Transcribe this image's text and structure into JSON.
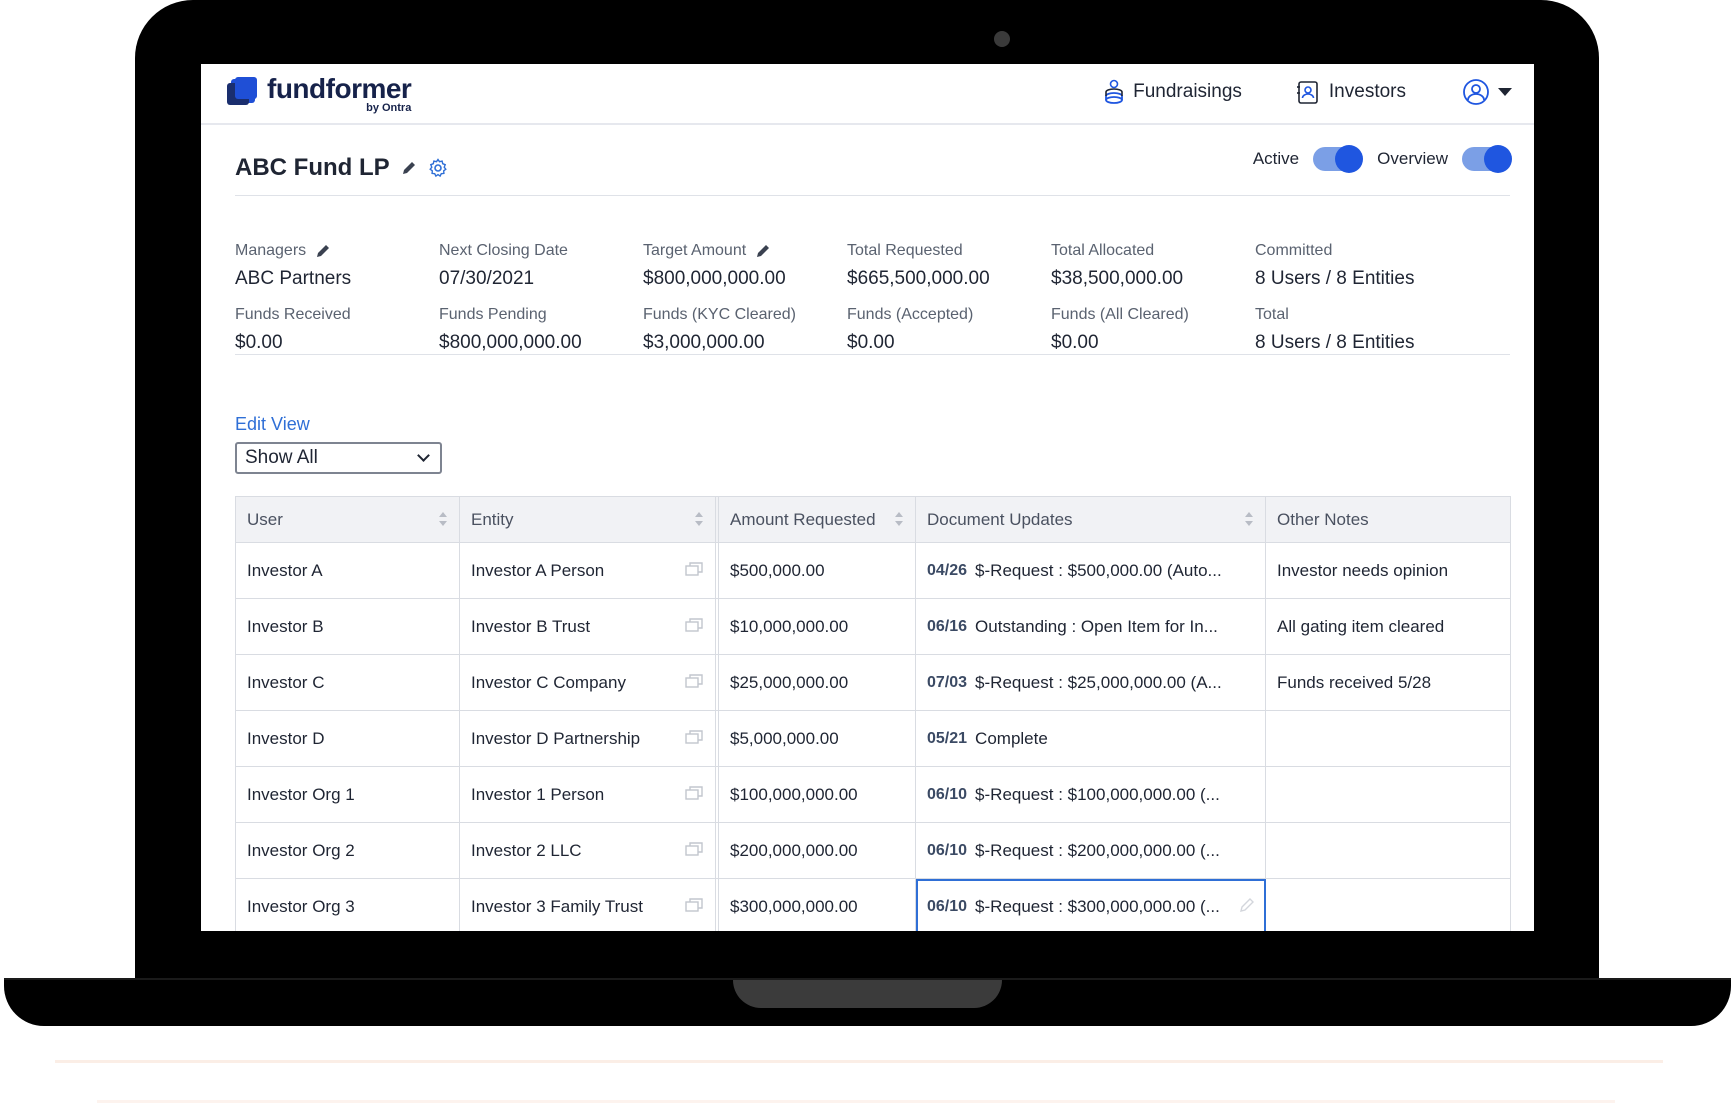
{
  "app": {
    "logo_word": "fundformer",
    "logo_sub": "by Ontra"
  },
  "nav": {
    "fundraisings": "Fundraisings",
    "investors": "Investors"
  },
  "fund": {
    "title": "ABC Fund LP",
    "toggle_active_label": "Active",
    "toggle_overview_label": "Overview"
  },
  "stats": [
    {
      "label": "Managers",
      "value": "ABC Partners",
      "editable": true
    },
    {
      "label": "Next Closing Date",
      "value": "07/30/2021",
      "editable": false
    },
    {
      "label": "Target Amount",
      "value": "$800,000,000.00",
      "editable": true
    },
    {
      "label": "Total Requested",
      "value": "$665,500,000.00",
      "editable": false
    },
    {
      "label": "Total Allocated",
      "value": "$38,500,000.00",
      "editable": false
    },
    {
      "label": "Committed",
      "value": "8 Users / 8 Entities",
      "editable": false
    },
    {
      "label": "Funds Received",
      "value": "$0.00",
      "editable": false
    },
    {
      "label": "Funds Pending",
      "value": "$800,000,000.00",
      "editable": false
    },
    {
      "label": "Funds (KYC Cleared)",
      "value": "$3,000,000.00",
      "editable": false
    },
    {
      "label": "Funds (Accepted)",
      "value": "$0.00",
      "editable": false
    },
    {
      "label": "Funds (All Cleared)",
      "value": "$0.00",
      "editable": false
    },
    {
      "label": "Total",
      "value": "8 Users / 8 Entities",
      "editable": false
    }
  ],
  "view": {
    "edit_view_label": "Edit View",
    "selected": "Show All"
  },
  "table": {
    "headers": [
      "User",
      "Entity",
      "Amount Requested",
      "Document Updates",
      "Other Notes"
    ],
    "rows": [
      {
        "user": "Investor A",
        "entity": "Investor A Person",
        "amount": "$500,000.00",
        "doc_date": "04/26",
        "doc_text": "$-Request : $500,000.00 (Auto...",
        "notes": "Investor needs opinion"
      },
      {
        "user": "Investor B",
        "entity": "Investor B Trust",
        "amount": "$10,000,000.00",
        "doc_date": "06/16",
        "doc_text": "Outstanding : Open Item for In...",
        "notes": "All gating item cleared"
      },
      {
        "user": "Investor C",
        "entity": "Investor C Company",
        "amount": "$25,000,000.00",
        "doc_date": "07/03",
        "doc_text": "$-Request : $25,000,000.00 (A...",
        "notes": "Funds received 5/28"
      },
      {
        "user": "Investor D",
        "entity": "Investor D Partnership",
        "amount": "$5,000,000.00",
        "doc_date": "05/21",
        "doc_text": "Complete",
        "notes": ""
      },
      {
        "user": "Investor Org 1",
        "entity": "Investor 1 Person",
        "amount": "$100,000,000.00",
        "doc_date": "06/10",
        "doc_text": "$-Request : $100,000,000.00 (...",
        "notes": ""
      },
      {
        "user": "Investor Org 2",
        "entity": "Investor 2 LLC",
        "amount": "$200,000,000.00",
        "doc_date": "06/10",
        "doc_text": "$-Request : $200,000,000.00 (...",
        "notes": ""
      },
      {
        "user": "Investor Org 3",
        "entity": "Investor 3 Family Trust",
        "amount": "$300,000,000.00",
        "doc_date": "06/10",
        "doc_text": "$-Request : $300,000,000.00 (...",
        "notes": ""
      }
    ]
  },
  "colors": {
    "accent": "#1f56e0",
    "link": "#2f6fd6",
    "text": "#1f2533"
  }
}
